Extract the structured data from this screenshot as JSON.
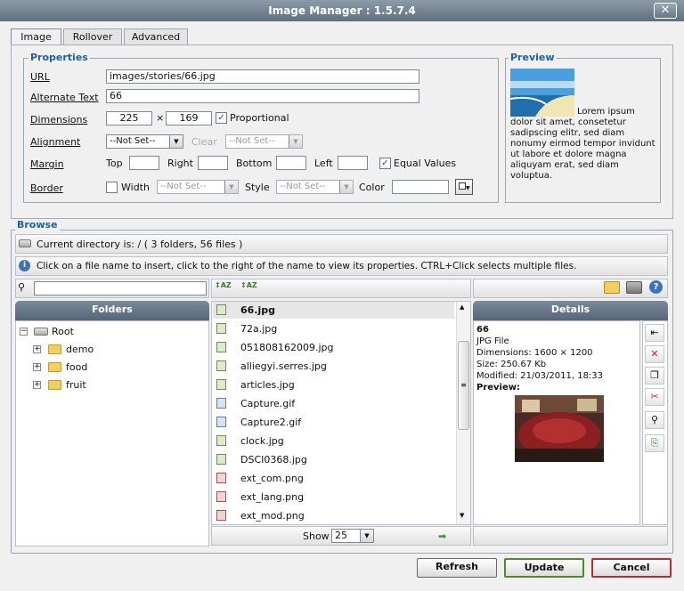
{
  "window": {
    "title": "Image Manager : 1.5.7.4",
    "close": "✕"
  },
  "tabs": [
    "Image",
    "Rollover",
    "Advanced"
  ],
  "properties": {
    "legend": "Properties",
    "url_label": "URL",
    "url_value": "images/stories/66.jpg",
    "alt_label": "Alternate Text",
    "alt_value": "66",
    "dim_label": "Dimensions",
    "width": "225",
    "times": "×",
    "height": "169",
    "proportional": "Proportional",
    "align_label": "Alignment",
    "align_value": "--Not Set--",
    "clear_label": "Clear",
    "clear_value": "--Not Set--",
    "margin_label": "Margin",
    "top": "Top",
    "right": "Right",
    "bottom": "Bottom",
    "left": "Left",
    "equal": "Equal Values",
    "border_label": "Border",
    "bwidth": "Width",
    "bwidth_value": "--Not Set--",
    "bstyle": "Style",
    "bstyle_value": "--Not Set--",
    "bcolor": "Color"
  },
  "preview": {
    "legend": "Preview",
    "text": "Lorem ipsum dolor sit amet, consetetur sadipscing elitr, sed diam nonumy eirmod tempor invidunt ut labore et dolore magna aliquyam erat, sed diam voluptua."
  },
  "browse": {
    "legend": "Browse",
    "current_dir": "Current directory is: / ( 3 folders, 56 files )",
    "info": "Click on a file name to insert, click to the right of the name to view its properties. CTRL+Click selects multiple files.",
    "folders_header": "Folders",
    "details_header": "Details",
    "root": "Root",
    "folders": [
      "demo",
      "food",
      "fruit"
    ],
    "files": [
      {
        "name": "66.jpg",
        "type": "jpg"
      },
      {
        "name": "72a.jpg",
        "type": "jpg"
      },
      {
        "name": "051808162009.jpg",
        "type": "jpg"
      },
      {
        "name": "alliegyi.serres.jpg",
        "type": "jpg"
      },
      {
        "name": "articles.jpg",
        "type": "jpg"
      },
      {
        "name": "Capture.gif",
        "type": "gif"
      },
      {
        "name": "Capture2.gif",
        "type": "gif"
      },
      {
        "name": "clock.jpg",
        "type": "jpg"
      },
      {
        "name": "DSCI0368.jpg",
        "type": "jpg"
      },
      {
        "name": "ext_com.png",
        "type": "png"
      },
      {
        "name": "ext_lang.png",
        "type": "png"
      },
      {
        "name": "ext_mod.png",
        "type": "png"
      }
    ],
    "show_label": "Show",
    "show_value": "25",
    "details": {
      "name": "66",
      "type": "JPG File",
      "dimensions": "Dimensions: 1600 × 1200",
      "size": "Size: 250.67 Kb",
      "modified": "Modified: 21/03/2011, 18:33",
      "preview": "Preview:"
    }
  },
  "buttons": {
    "refresh": "Refresh",
    "update": "Update",
    "cancel": "Cancel"
  },
  "colors": {
    "accent": "#1f5f9e",
    "update_border": "#4d8a2a",
    "cancel_border": "#b03030"
  }
}
